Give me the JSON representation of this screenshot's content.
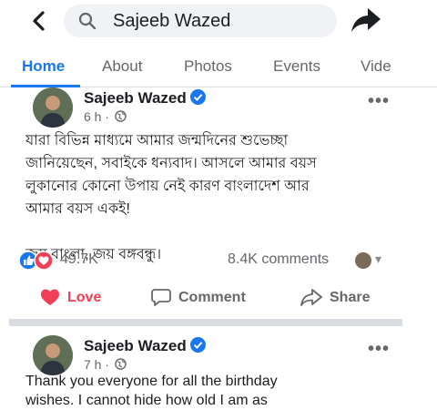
{
  "search": {
    "query": "Sajeeb Wazed"
  },
  "icons": {
    "back": "chevron-left-icon",
    "search": "magnifier-icon",
    "share": "share-arrow-icon",
    "verified": "verified-badge-icon",
    "globe": "public-globe-icon",
    "more": "more-options-icon",
    "like": "like-reaction-icon",
    "love": "love-reaction-icon",
    "comment": "comment-icon"
  },
  "tabs": [
    {
      "label": "Home"
    },
    {
      "label": "About"
    },
    {
      "label": "Photos"
    },
    {
      "label": "Events"
    },
    {
      "label": "Vide"
    }
  ],
  "posts": [
    {
      "author": "Sajeeb Wazed",
      "time": "6 h",
      "more": "•••",
      "lines": [
        "যারা বিভিন্ন মাধ্যমে আমার জন্মদিনের শুভেচ্ছা",
        "জানিয়েছেন, সবাইকে ধন্যবাদ। আসলে আমার বয়স",
        "লুকানোর কোনো উপায় নেই কারণ বাংলাদেশ আর",
        "আমার বয়স একই!",
        "",
        "জয় বাংলা, জয় বঙ্গবন্ধু।"
      ],
      "reaction_count": "49.7K",
      "comment_count": "8.4K comments"
    },
    {
      "author": "Sajeeb Wazed",
      "time": "7 h",
      "more": "•••",
      "lines": [
        "Thank you everyone for all the birthday",
        "wishes. I cannot hide how old I am as"
      ]
    }
  ],
  "actions": {
    "love": "Love",
    "comment": "Comment",
    "share": "Share"
  },
  "colors": {
    "accent": "#1877f2",
    "love": "#f33e58",
    "muted": "#65676b",
    "divider": "#dadde1"
  }
}
